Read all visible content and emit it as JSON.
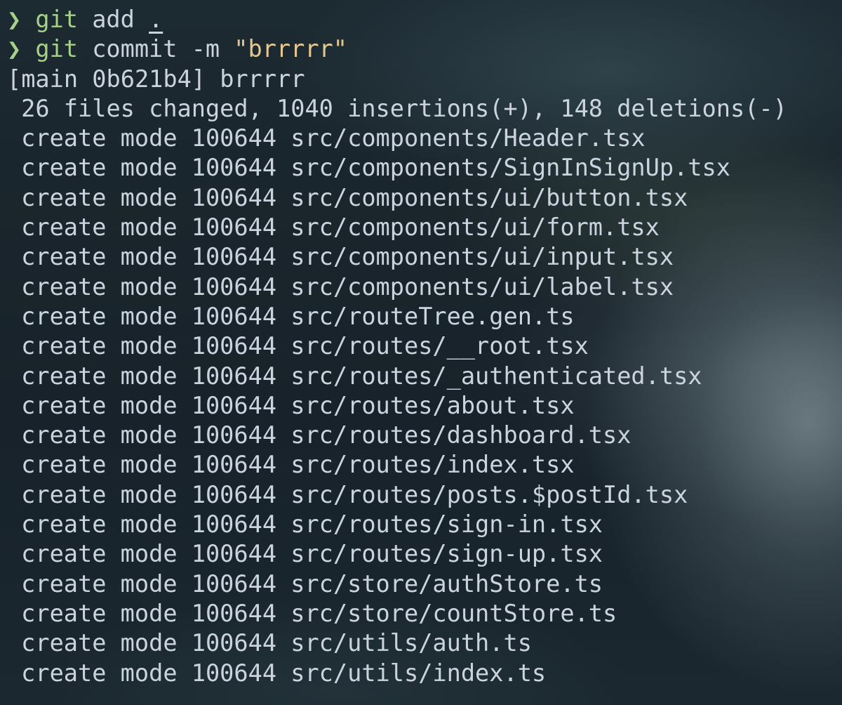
{
  "terminal": {
    "colors": {
      "prompt": "#a6d189",
      "string": "#e5c890",
      "text": "#ccd3e0"
    },
    "commands": [
      {
        "prompt": "❯",
        "program": "git",
        "args": "add",
        "target": "."
      },
      {
        "prompt": "❯",
        "program": "git",
        "args": "commit -m",
        "message": "\"brrrrr\""
      }
    ],
    "commit_header": "[main 0b621b4] brrrrr",
    "summary": "26 files changed, 1040 insertions(+), 148 deletions(-)",
    "created_files": [
      "create mode 100644 src/components/Header.tsx",
      "create mode 100644 src/components/SignInSignUp.tsx",
      "create mode 100644 src/components/ui/button.tsx",
      "create mode 100644 src/components/ui/form.tsx",
      "create mode 100644 src/components/ui/input.tsx",
      "create mode 100644 src/components/ui/label.tsx",
      "create mode 100644 src/routeTree.gen.ts",
      "create mode 100644 src/routes/__root.tsx",
      "create mode 100644 src/routes/_authenticated.tsx",
      "create mode 100644 src/routes/about.tsx",
      "create mode 100644 src/routes/dashboard.tsx",
      "create mode 100644 src/routes/index.tsx",
      "create mode 100644 src/routes/posts.$postId.tsx",
      "create mode 100644 src/routes/sign-in.tsx",
      "create mode 100644 src/routes/sign-up.tsx",
      "create mode 100644 src/store/authStore.ts",
      "create mode 100644 src/store/countStore.ts",
      "create mode 100644 src/utils/auth.ts",
      "create mode 100644 src/utils/index.ts"
    ]
  }
}
